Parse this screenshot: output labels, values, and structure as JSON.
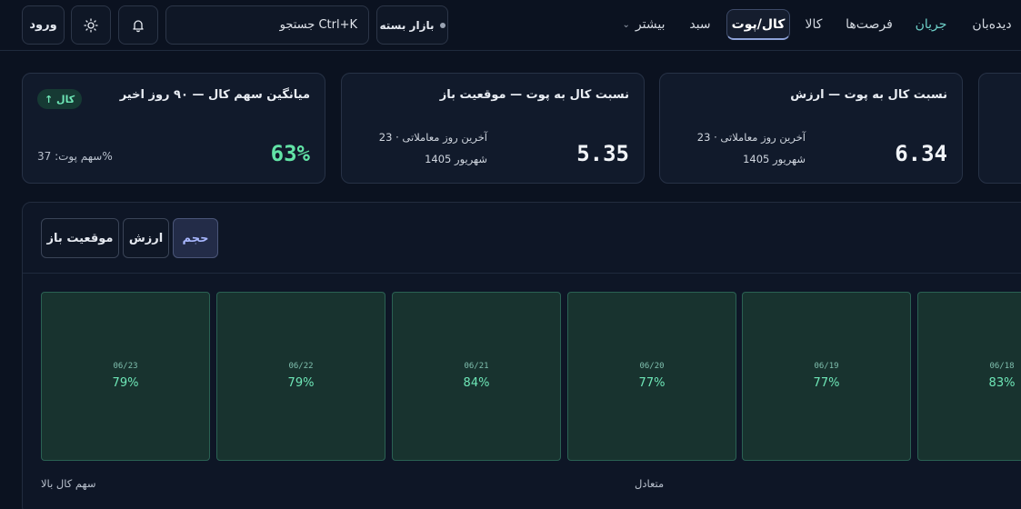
{
  "topbar": {
    "login_label": "ورود",
    "theme_icon": "sun-icon",
    "bell_icon": "bell-icon",
    "search_placeholder": "جستجو Ctrl+K",
    "market_status": "بازار بسته",
    "nav": [
      {
        "label": "دیده‌بان",
        "state": "normal"
      },
      {
        "label": "جریان",
        "state": "accent"
      },
      {
        "label": "فرصت‌ها",
        "state": "normal"
      },
      {
        "label": "کالا",
        "state": "normal"
      },
      {
        "label": "کال/پوت",
        "state": "active"
      },
      {
        "label": "سبد",
        "state": "normal"
      },
      {
        "label": "بیشتر",
        "state": "dropdown"
      }
    ]
  },
  "cards": {
    "value_ratio": {
      "title": "نسبت کال به پوت — ارزش",
      "value": "6.34",
      "sub_line1": "آخرین روز معاملاتی · 23",
      "sub_line2": "شهریور 1405"
    },
    "oi_ratio": {
      "title": "نسبت کال به پوت — موقعیت باز",
      "value": "5.35",
      "sub_line1": "آخرین روز معاملاتی · 23",
      "sub_line2": "شهریور 1405"
    },
    "avg_call": {
      "title": "میانگین سهم کال — ۹۰ روز اخیر",
      "value": "63%",
      "badge": "↑ کال",
      "put_share": "سهم پوت: 37%"
    }
  },
  "panel": {
    "tabs": [
      {
        "label": "حجم",
        "active": true
      },
      {
        "label": "ارزش",
        "active": false
      },
      {
        "label": "موقعیت باز",
        "active": false
      }
    ],
    "tiles": [
      {
        "date": "06/23",
        "value": "79%"
      },
      {
        "date": "06/22",
        "value": "79%"
      },
      {
        "date": "06/21",
        "value": "84%"
      },
      {
        "date": "06/20",
        "value": "77%"
      },
      {
        "date": "06/19",
        "value": "77%"
      },
      {
        "date": "06/18",
        "value": "83%"
      }
    ],
    "legend_high": "سهم کال بالا",
    "legend_mid": "متعادل"
  },
  "colors": {
    "accent_green": "#62e3a6",
    "tile_bg": "#18332f",
    "active_tab": "#a9b8ff"
  }
}
